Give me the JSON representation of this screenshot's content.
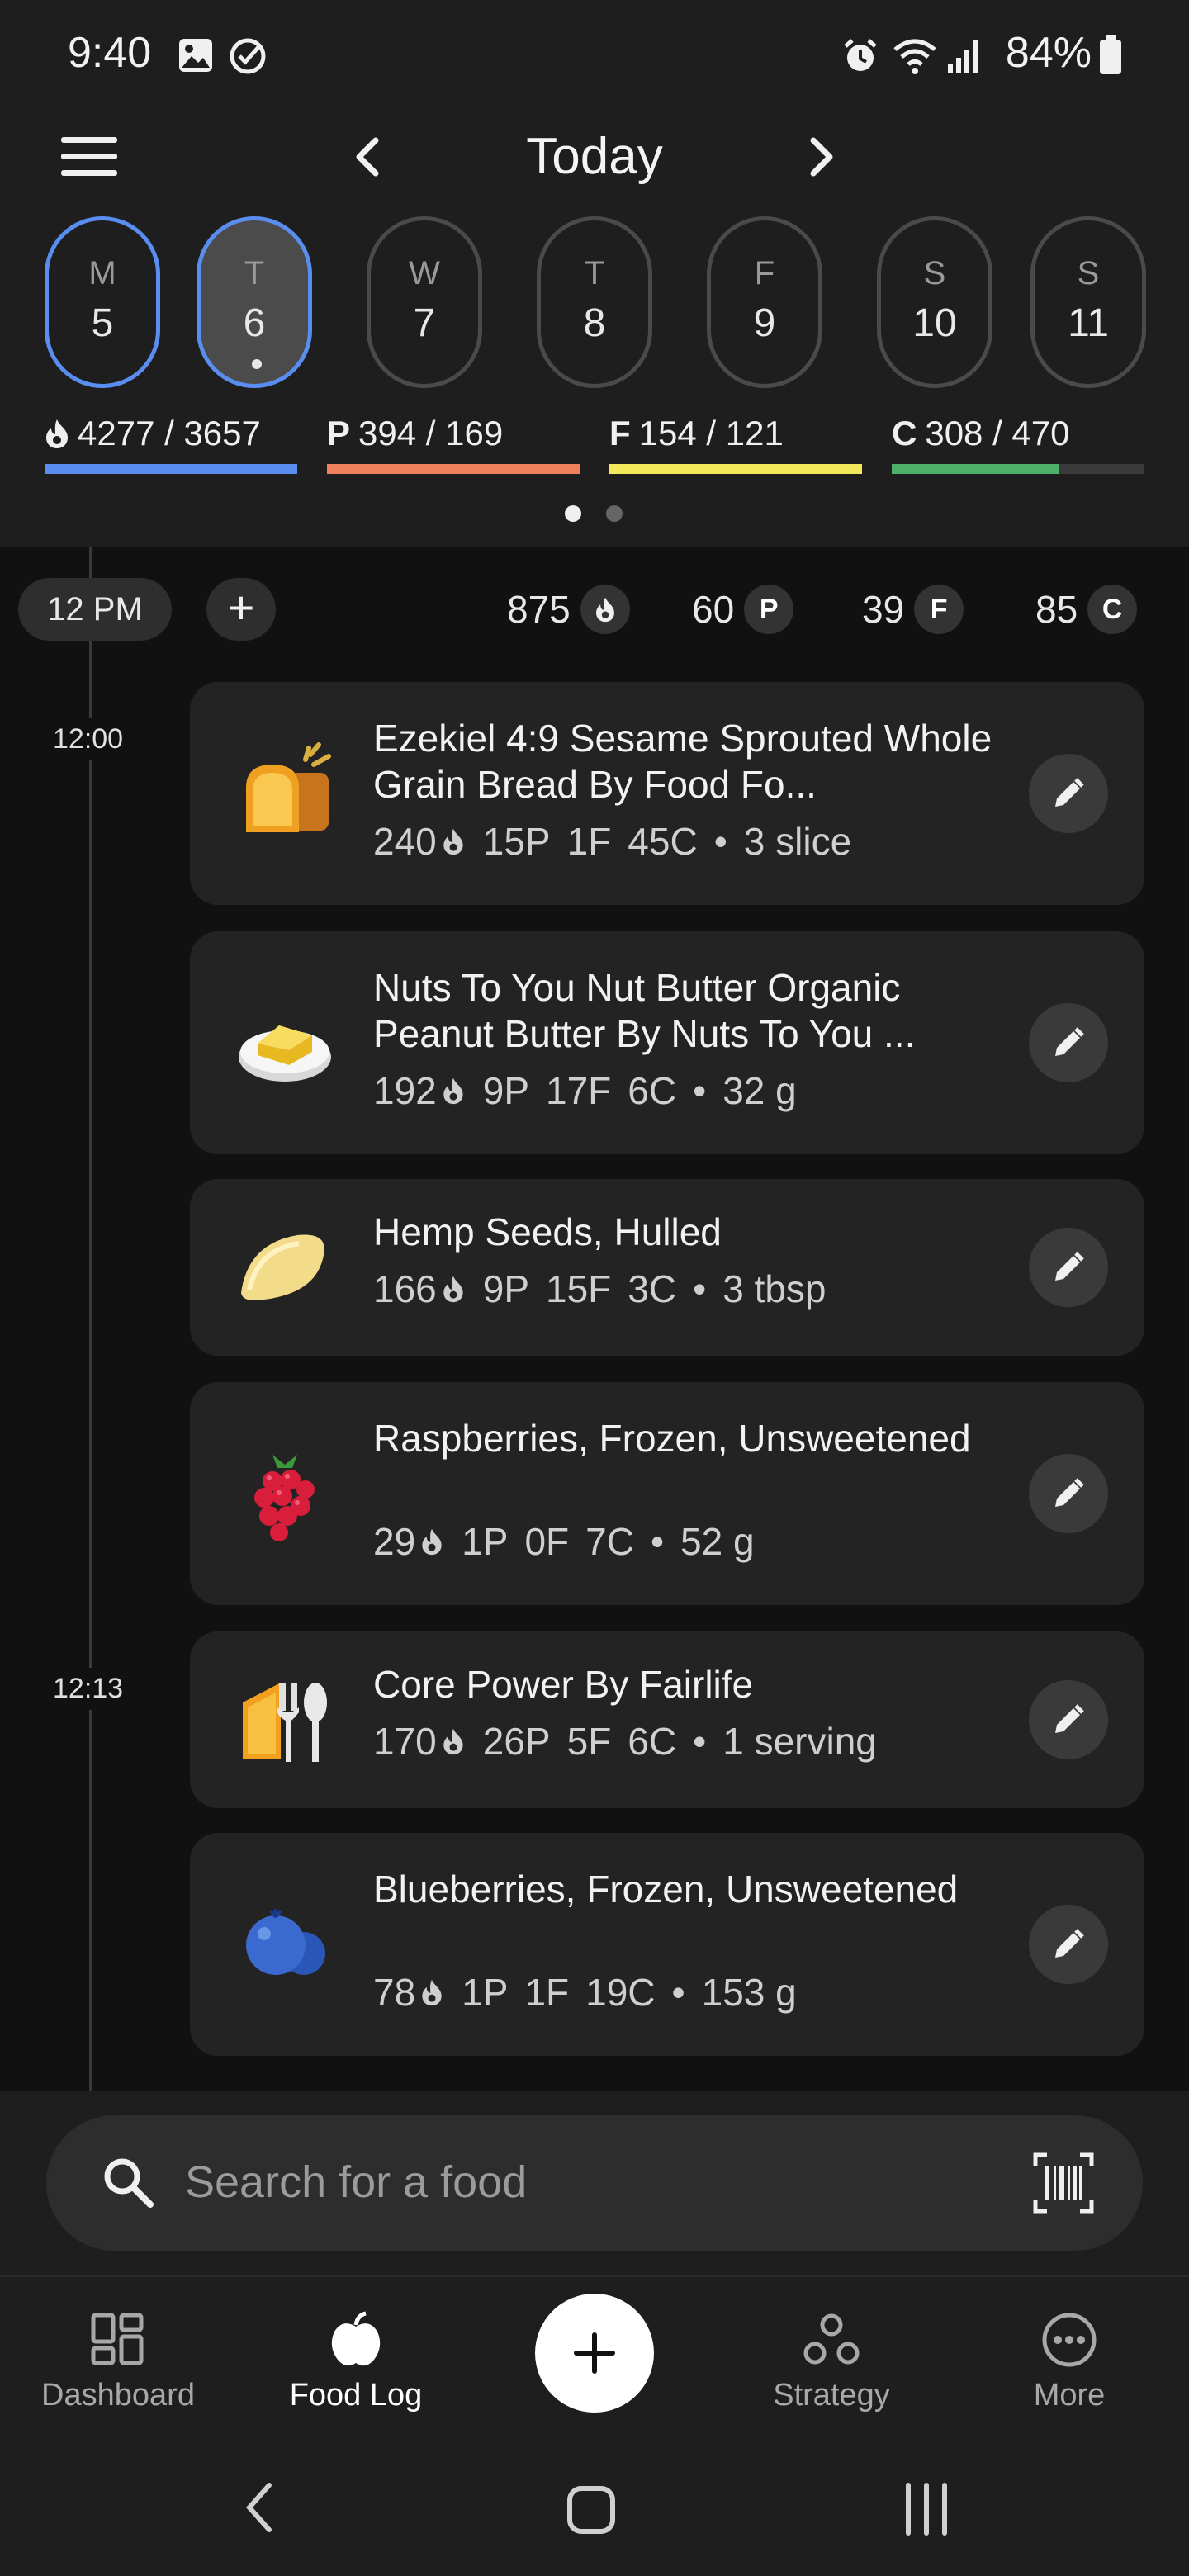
{
  "status_bar": {
    "time": "9:40",
    "battery": "84%"
  },
  "header": {
    "title": "Today",
    "days": [
      {
        "letter": "M",
        "num": "5"
      },
      {
        "letter": "T",
        "num": "6"
      },
      {
        "letter": "W",
        "num": "7"
      },
      {
        "letter": "T",
        "num": "8"
      },
      {
        "letter": "F",
        "num": "9"
      },
      {
        "letter": "S",
        "num": "10"
      },
      {
        "letter": "S",
        "num": "11"
      }
    ],
    "macros": {
      "calories": {
        "text": "4277 / 3657",
        "color": "#5b8df0",
        "progress": 1.0
      },
      "protein": {
        "label": "P",
        "text": "394 / 169",
        "color": "#f07f5c",
        "progress": 1.0
      },
      "fat": {
        "label": "F",
        "text": "154 / 121",
        "color": "#f2e85a",
        "progress": 1.0
      },
      "carbs": {
        "label": "C",
        "text": "308 / 470",
        "color": "#4caf6a",
        "progress": 0.66
      }
    }
  },
  "meal": {
    "time_chip": "12 PM",
    "add": "+",
    "totals": {
      "cal": "875",
      "protein": "60",
      "fat": "39",
      "carbs": "85"
    },
    "badges": {
      "p": "P",
      "f": "F",
      "c": "C"
    }
  },
  "timestamps": [
    "12:00",
    "12:13"
  ],
  "foods": [
    {
      "name": "Ezekiel 4:9 Sesame Sprouted Whole Grain Bread By Food Fo...",
      "cal": "240",
      "p": "15P",
      "f": "1F",
      "c": "45C",
      "qty": "3 slice",
      "icon": "bread-icon"
    },
    {
      "name": "Nuts To You Nut Butter Organic Peanut Butter By Nuts To You ...",
      "cal": "192",
      "p": "9P",
      "f": "17F",
      "c": "6C",
      "qty": "32 g",
      "icon": "butter-icon"
    },
    {
      "name": "Hemp Seeds, Hulled",
      "cal": "166",
      "p": "9P",
      "f": "15F",
      "c": "3C",
      "qty": "3 tbsp",
      "icon": "seed-icon"
    },
    {
      "name": "Raspberries, Frozen, Unsweetened",
      "cal": "29",
      "p": "1P",
      "f": "0F",
      "c": "7C",
      "qty": "52 g",
      "icon": "raspberry-icon"
    },
    {
      "name": "Core Power By Fairlife",
      "cal": "170",
      "p": "26P",
      "f": "5F",
      "c": "6C",
      "qty": "1 serving",
      "icon": "cutlery-icon"
    },
    {
      "name": "Blueberries, Frozen, Unsweetened",
      "cal": "78",
      "p": "1P",
      "f": "1F",
      "c": "19C",
      "qty": "153 g",
      "icon": "blueberry-icon"
    }
  ],
  "search": {
    "placeholder": "Search for a food"
  },
  "bottom_nav": {
    "dashboard": "Dashboard",
    "food_log": "Food Log",
    "strategy": "Strategy",
    "more": "More"
  },
  "bullet": "•"
}
